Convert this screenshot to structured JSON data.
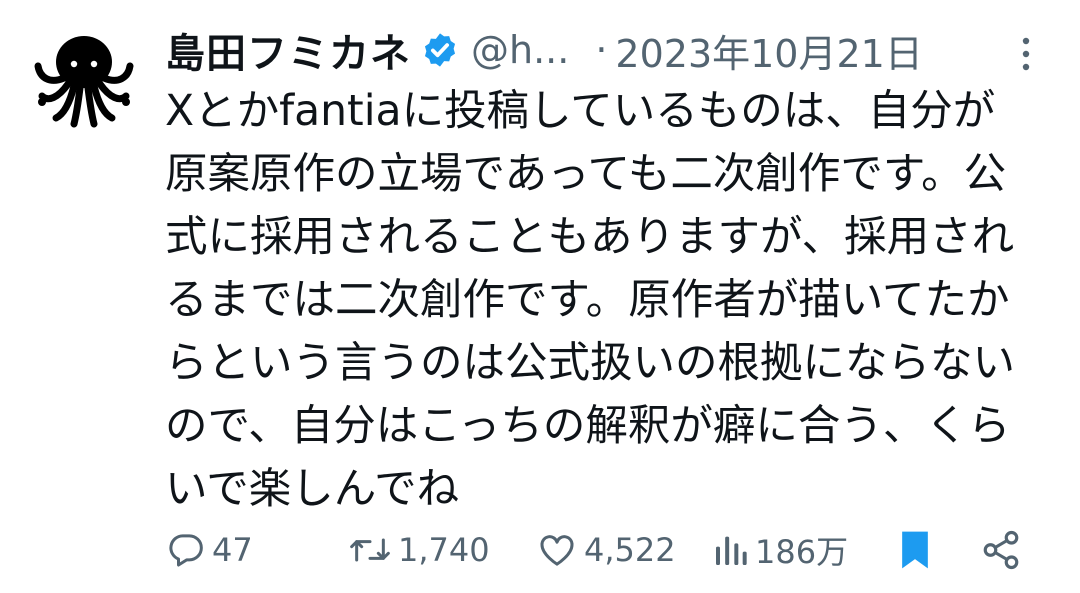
{
  "author": {
    "display_name": "島田フミカネ",
    "handle": "@h...",
    "verified": true,
    "separator": "·",
    "timestamp": "2023年10月21日",
    "avatar_icon": "octopus-avatar-icon"
  },
  "tweet": {
    "text": "Xとかfantiaに投稿しているものは、自分が\n原案原作の立場であっても二次創作です。公\n式に採用されることもありますが、採用され\nるまでは二次創作です。原作者が描いてたか\nらという言うのは公式扱いの根拠にならない\nので、自分はこっちの解釈が癖に合う、くら\nいで楽しんでね"
  },
  "actions": {
    "reply": {
      "icon": "reply-icon",
      "count": "47"
    },
    "retweet": {
      "icon": "retweet-icon",
      "count": "1,740"
    },
    "like": {
      "icon": "heart-icon",
      "count": "4,522"
    },
    "views": {
      "icon": "views-icon",
      "count": "186万"
    },
    "bookmark": {
      "icon": "bookmark-icon",
      "active": true
    },
    "share": {
      "icon": "share-icon"
    }
  },
  "colors": {
    "text_primary": "#0f1419",
    "text_secondary": "#536471",
    "accent": "#1d9bf0"
  }
}
